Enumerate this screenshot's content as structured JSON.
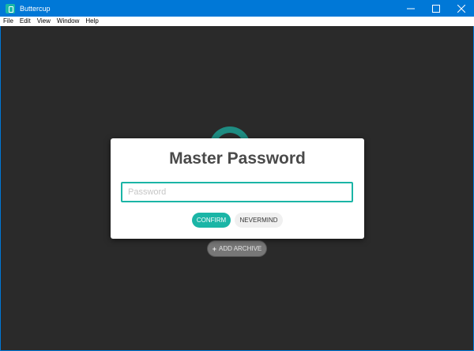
{
  "window": {
    "title": "Buttercup",
    "icon": "buttercup-app-icon",
    "controls": [
      "minimize-icon",
      "maximize-icon",
      "close-icon"
    ]
  },
  "menu": {
    "items": [
      "File",
      "Edit",
      "View",
      "Window",
      "Help"
    ]
  },
  "background": {
    "add_archive_label": "ADD ARCHIVE",
    "add_archive_icon": "+"
  },
  "modal": {
    "title": "Master Password",
    "password_placeholder": "Password",
    "password_value": "",
    "confirm_label": "CONFIRM",
    "nevermind_label": "NEVERMIND"
  },
  "colors": {
    "accent": "#1bb5a6",
    "titlebar": "#0078d7",
    "content_bg": "#2a2a2a"
  }
}
